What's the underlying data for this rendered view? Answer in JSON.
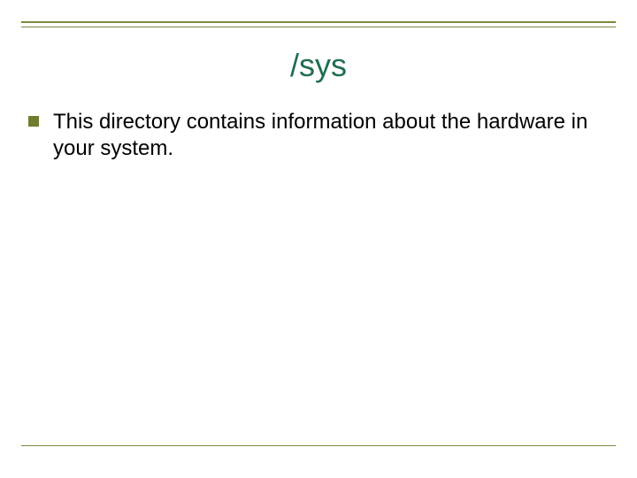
{
  "title": "/sys",
  "bullets": [
    {
      "text": "This directory contains information about the hardware in your system."
    }
  ]
}
